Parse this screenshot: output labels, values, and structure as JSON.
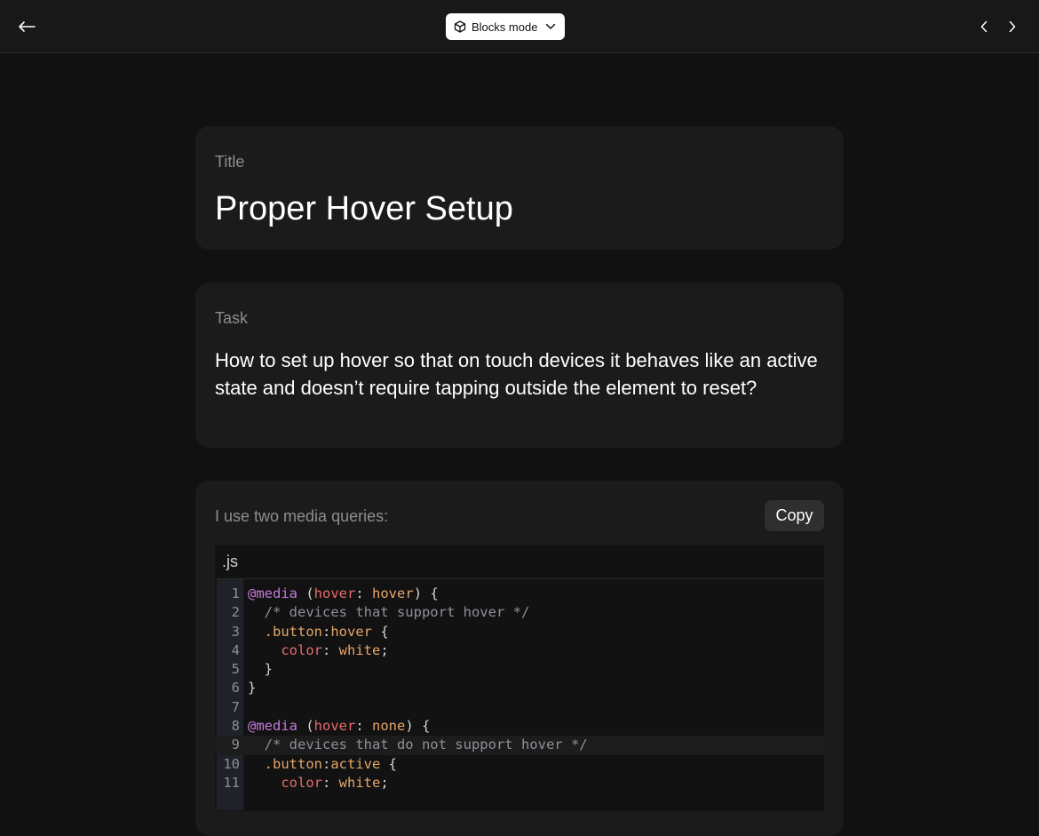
{
  "topbar": {
    "mode_label": "Blocks mode",
    "icons": {
      "back": "arrow-left-icon",
      "mode": "cube-icon",
      "dropdown": "chevron-down-icon",
      "prev": "chevron-left-icon",
      "next": "chevron-right-icon"
    }
  },
  "title_card": {
    "label": "Title",
    "value": "Proper Hover Setup"
  },
  "task_card": {
    "label": "Task",
    "value": "How to set up hover so that on touch devices it behaves like an active state and doesn’t require tapping outside the element to reset?"
  },
  "answer_card": {
    "intro": "I use two media queries:",
    "copy_label": "Copy",
    "code_lang": ".js",
    "code_lines": [
      {
        "n": "1",
        "tokens": [
          [
            "at",
            "@media"
          ],
          [
            "p",
            " ("
          ],
          [
            "prop",
            "hover"
          ],
          [
            "p",
            ": "
          ],
          [
            "val",
            "hover"
          ],
          [
            "p",
            ") {"
          ]
        ]
      },
      {
        "n": "2",
        "tokens": [
          [
            "com",
            "  /* devices that support hover */"
          ]
        ]
      },
      {
        "n": "3",
        "tokens": [
          [
            "p",
            "  "
          ],
          [
            "sel",
            ".button"
          ],
          [
            "p",
            ":"
          ],
          [
            "sel",
            "hover"
          ],
          [
            "p",
            " {"
          ]
        ]
      },
      {
        "n": "4",
        "tokens": [
          [
            "p",
            "    "
          ],
          [
            "prop",
            "color"
          ],
          [
            "p",
            ": "
          ],
          [
            "val",
            "white"
          ],
          [
            "p",
            ";"
          ]
        ]
      },
      {
        "n": "5",
        "tokens": [
          [
            "p",
            "  }"
          ]
        ]
      },
      {
        "n": "6",
        "tokens": [
          [
            "p",
            "}"
          ]
        ]
      },
      {
        "n": "7",
        "tokens": [
          [
            "p",
            ""
          ]
        ]
      },
      {
        "n": "8",
        "tokens": [
          [
            "at",
            "@media"
          ],
          [
            "p",
            " ("
          ],
          [
            "prop",
            "hover"
          ],
          [
            "p",
            ": "
          ],
          [
            "val",
            "none"
          ],
          [
            "p",
            ") {"
          ]
        ]
      },
      {
        "n": "9",
        "highlight": true,
        "tokens": [
          [
            "com",
            "  /* devices that do not support hover */"
          ]
        ]
      },
      {
        "n": "10",
        "tokens": [
          [
            "p",
            "  "
          ],
          [
            "sel",
            ".button"
          ],
          [
            "p",
            ":"
          ],
          [
            "sel",
            "active"
          ],
          [
            "p",
            " {"
          ]
        ]
      },
      {
        "n": "11",
        "tokens": [
          [
            "p",
            "    "
          ],
          [
            "prop",
            "color"
          ],
          [
            "p",
            ": "
          ],
          [
            "val",
            "white"
          ],
          [
            "p",
            ";"
          ]
        ]
      }
    ]
  },
  "colors": {
    "background": "#111111",
    "card": "#1b1b1b",
    "keyword": "#c678dd",
    "property": "#e86b6b",
    "value": "#e5a66a",
    "comment": "#8d919a"
  }
}
